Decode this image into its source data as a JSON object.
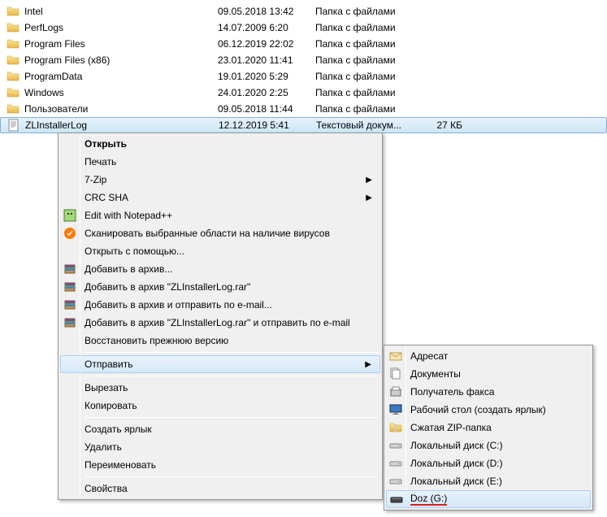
{
  "files": [
    {
      "name": "Intel",
      "date": "09.05.2018 13:42",
      "type": "Папка с файлами",
      "kind": "folder"
    },
    {
      "name": "PerfLogs",
      "date": "14.07.2009 6:20",
      "type": "Папка с файлами",
      "kind": "folder"
    },
    {
      "name": "Program Files",
      "date": "06.12.2019 22:02",
      "type": "Папка с файлами",
      "kind": "folder"
    },
    {
      "name": "Program Files (x86)",
      "date": "23.01.2020 11:41",
      "type": "Папка с файлами",
      "kind": "folder"
    },
    {
      "name": "ProgramData",
      "date": "19.01.2020 5:29",
      "type": "Папка с файлами",
      "kind": "folder"
    },
    {
      "name": "Windows",
      "date": "24.01.2020 2:25",
      "type": "Папка с файлами",
      "kind": "folder"
    },
    {
      "name": "Пользователи",
      "date": "09.05.2018 11:44",
      "type": "Папка с файлами",
      "kind": "folder"
    },
    {
      "name": "ZLInstallerLog",
      "date": "12.12.2019 5:41",
      "type": "Текстовый докум...",
      "size": "27 КБ",
      "kind": "txt",
      "selected": true
    }
  ],
  "menu": {
    "open": "Открыть",
    "print": "Печать",
    "sevenzip": "7-Zip",
    "crcsha": "CRC SHA",
    "npp": "Edit with Notepad++",
    "avast": "Сканировать выбранные области на наличие вирусов",
    "openwith": "Открыть с помощью...",
    "rar_add": "Добавить в архив...",
    "rar_addname": "Добавить в архив \"ZLInstallerLog.rar\"",
    "rar_email": "Добавить в архив и отправить по e-mail...",
    "rar_nameemail": "Добавить в архив \"ZLInstallerLog.rar\" и отправить по e-mail",
    "restore": "Восстановить прежнюю версию",
    "sendto": "Отправить",
    "cut": "Вырезать",
    "copy": "Копировать",
    "shortcut": "Создать ярлык",
    "delete": "Удалить",
    "rename": "Переименовать",
    "properties": "Свойства"
  },
  "submenu": {
    "recipient": "Адресат",
    "documents": "Документы",
    "fax": "Получатель факса",
    "desktop": "Рабочий стол (создать ярлык)",
    "zip": "Сжатая ZIP-папка",
    "diskc": "Локальный диск (C:)",
    "diskd": "Локальный диск (D:)",
    "diske": "Локальный диск (E:)",
    "diskg": "Doz (G:)"
  }
}
